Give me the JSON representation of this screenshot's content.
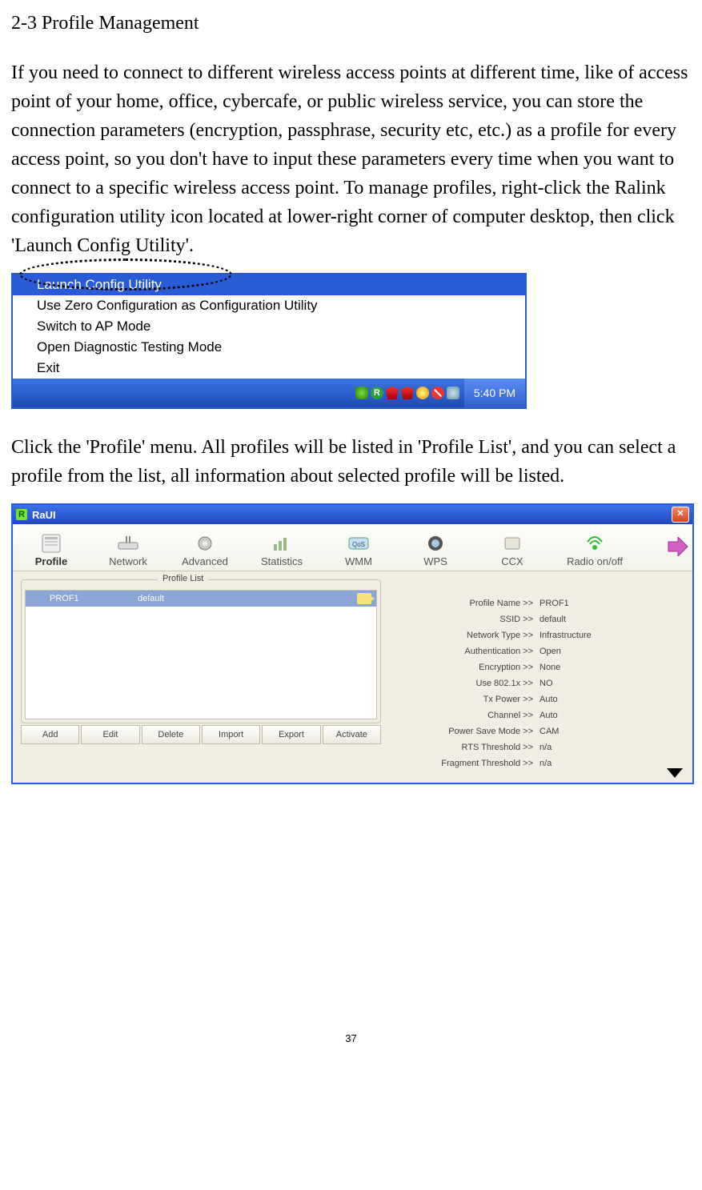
{
  "heading": "2-3 Profile Management",
  "paragraph1": "If you need to connect to different wireless access points at different time, like of access point of your home, office, cybercafe, or public wireless service, you can store the connection parameters (encryption, passphrase, security etc, etc.) as a profile for every access point, so you don't have to input these parameters every time when you want to connect to a specific wireless access point. To manage profiles, right-click the Ralink configuration utility icon located at lower-right corner of computer desktop, then click 'Launch Config Utility'.",
  "paragraph2": "Click the 'Profile' menu. All profiles will be listed in 'Profile List', and you can select a profile from the list, all information about selected profile will be listed.",
  "context_menu": {
    "items": [
      "Launch Config Utility",
      "Use Zero Configuration as Configuration Utility",
      "Switch to AP Mode",
      "Open Diagnostic Testing Mode",
      "Exit"
    ],
    "clock": "5:40 PM"
  },
  "raui": {
    "title": "RaUI",
    "tabs": [
      "Profile",
      "Network",
      "Advanced",
      "Statistics",
      "WMM",
      "WPS",
      "CCX",
      "Radio on/off"
    ],
    "profile_list_legend": "Profile List",
    "selected_profile": {
      "name": "PROF1",
      "ssid": "default"
    },
    "actions": [
      "Add",
      "Edit",
      "Delete",
      "Import",
      "Export",
      "Activate"
    ],
    "details": [
      {
        "label": "Profile Name >>",
        "value": "PROF1"
      },
      {
        "label": "SSID >>",
        "value": "default"
      },
      {
        "label": "Network Type >>",
        "value": "Infrastructure"
      },
      {
        "label": "Authentication >>",
        "value": "Open"
      },
      {
        "label": "Encryption >>",
        "value": "None"
      },
      {
        "label": "Use 802.1x >>",
        "value": "NO"
      },
      {
        "label": "Tx Power >>",
        "value": "Auto"
      },
      {
        "label": "Channel >>",
        "value": "Auto"
      },
      {
        "label": "Power Save Mode >>",
        "value": "CAM"
      },
      {
        "label": "RTS Threshold >>",
        "value": "n/a"
      },
      {
        "label": "Fragment Threshold >>",
        "value": "n/a"
      }
    ]
  },
  "page_number": "37"
}
